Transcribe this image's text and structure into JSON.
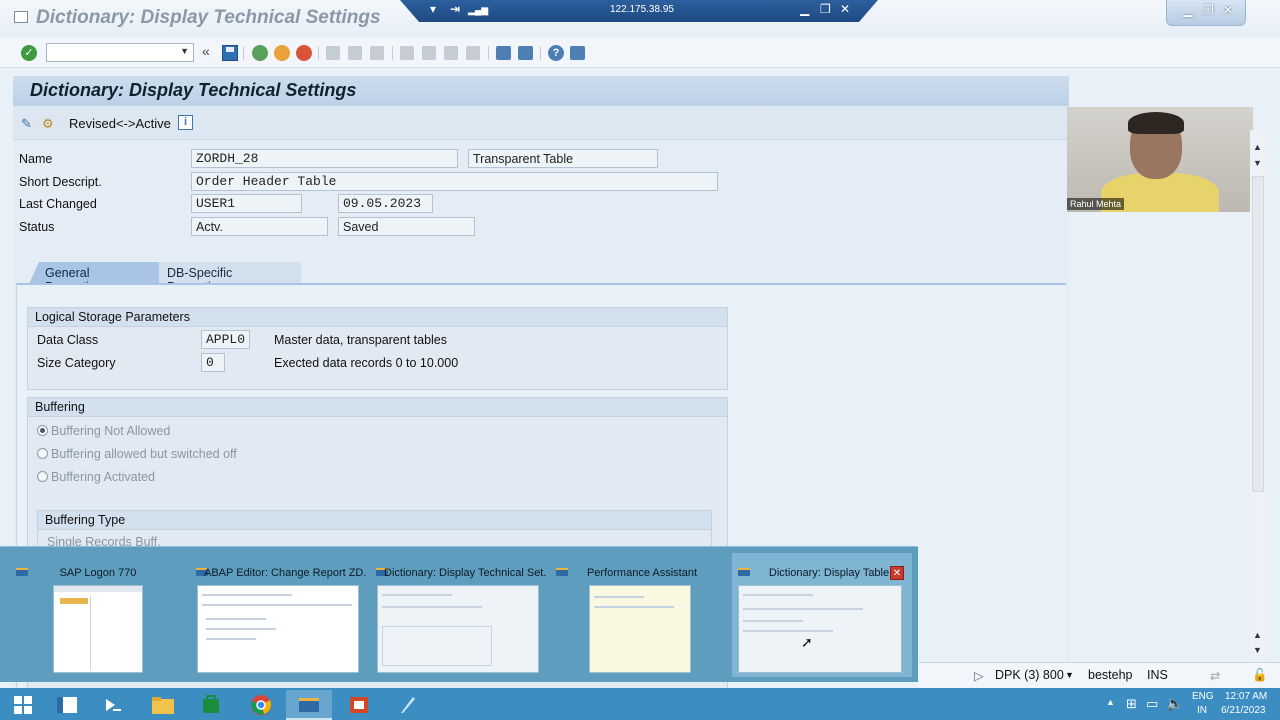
{
  "window": {
    "title": "Dictionary: Display Technical Settings",
    "rdp_ip": "122.175.38.95"
  },
  "page": {
    "title": "Dictionary: Display Technical Settings",
    "revised_active_label": "Revised<->Active"
  },
  "header_fields": {
    "name_label": "Name",
    "name_value": "ZORDH_28",
    "table_type": "Transparent Table",
    "short_desc_label": "Short Descript.",
    "short_desc_value": "Order Header Table",
    "last_changed_label": "Last Changed",
    "last_changed_user": "USER1",
    "last_changed_date": "09.05.2023",
    "status_label": "Status",
    "status_value": "Actv.",
    "status_saved": "Saved"
  },
  "tabs": [
    {
      "label": "General Properties",
      "active": true
    },
    {
      "label": "DB-Specific Properties",
      "active": false
    }
  ],
  "logical_storage": {
    "header": "Logical Storage Parameters",
    "data_class_label": "Data Class",
    "data_class_value": "APPL0",
    "data_class_desc": "Master data, transparent tables",
    "size_category_label": "Size Category",
    "size_category_value": "0",
    "size_category_desc": "Exected data records 0 to 10.000"
  },
  "buffering": {
    "header": "Buffering",
    "options": [
      {
        "label": "Buffering Not Allowed",
        "selected": true
      },
      {
        "label": "Buffering allowed but switched off",
        "selected": false
      },
      {
        "label": "Buffering Activated",
        "selected": false
      }
    ],
    "type_header": "Buffering Type",
    "type_first_option": "Single Records Buff."
  },
  "webcam": {
    "name": "Rahul Mehta"
  },
  "task_switcher": [
    {
      "label": "SAP Logon 770"
    },
    {
      "label": "ABAP Editor: Change Report ZD..."
    },
    {
      "label": "Dictionary: Display Technical Set..."
    },
    {
      "label": "Performance Assistant"
    },
    {
      "label": "Dictionary: Display Table",
      "selected": true
    }
  ],
  "sap_status": {
    "system": "DPK (3) 800",
    "host": "bestehp",
    "mode": "INS"
  },
  "taskbar": {
    "lang1": "ENG",
    "lang2": "IN",
    "time": "12:07 AM",
    "date": "6/21/2023"
  },
  "colors": {
    "accent": "#3b8dc2",
    "tab_active": "#a9c4e4",
    "content_bg": "#e4edf6"
  }
}
